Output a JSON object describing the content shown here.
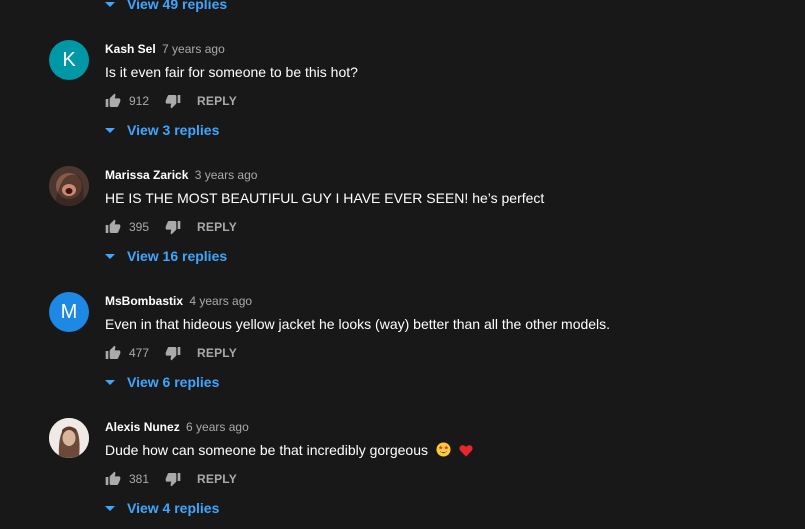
{
  "top_replies": {
    "label": "View 49 replies"
  },
  "comments": [
    {
      "avatar_letter": "K",
      "avatar_color": "#0097a7",
      "author": "Kash Sel",
      "time": "7 years ago",
      "text": "Is it even fair for someone to be this hot?",
      "likes": "912",
      "reply_label": "REPLY",
      "replies_label": "View 3 replies"
    },
    {
      "avatar_letter": "",
      "avatar_color": "#5a3f34",
      "author": "Marissa Zarick",
      "time": "3 years ago",
      "text": "HE IS THE MOST BEAUTIFUL GUY I HAVE EVER SEEN! he’s perfect",
      "likes": "395",
      "reply_label": "REPLY",
      "replies_label": "View 16 replies"
    },
    {
      "avatar_letter": "M",
      "avatar_color": "#1e88e5",
      "author": "MsBombastix",
      "time": "4 years ago",
      "text": "Even in that hideous yellow jacket he looks (way) better than all the other models.",
      "likes": "477",
      "reply_label": "REPLY",
      "replies_label": "View 6 replies"
    },
    {
      "avatar_letter": "",
      "avatar_color": "#e9e4df",
      "author": "Alexis Nunez",
      "time": "6 years ago",
      "text": "Dude how can someone be that incredibly gorgeous",
      "emojis": [
        "star-struck-emoji",
        "red-heart-emoji"
      ],
      "likes": "381",
      "reply_label": "REPLY",
      "replies_label": "View 4 replies"
    }
  ]
}
